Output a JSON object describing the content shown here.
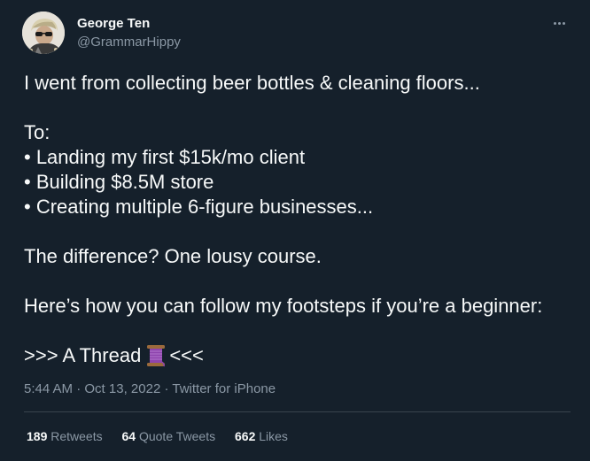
{
  "author": {
    "name": "George Ten",
    "handle": "@GrammarHippy",
    "avatar_icon": "profile-photo-avatar"
  },
  "tweet": {
    "lines": [
      "I went from collecting beer bottles & cleaning floors...",
      "",
      "To:",
      "• Landing my first $15k/mo client",
      "• Building $8.5M store",
      "• Creating multiple 6-figure businesses...",
      "",
      "The difference? One lousy course.",
      "",
      "Here’s how you can follow my footsteps if you’re a beginner:",
      ""
    ],
    "thread_prefix": ">>> A Thread",
    "thread_emoji_icon": "thread-spool-icon",
    "thread_suffix": "<<<"
  },
  "meta": {
    "time": "5:44 AM",
    "date": "Oct 13, 2022",
    "source": "Twitter for iPhone",
    "separator": "·"
  },
  "stats": {
    "retweets_count": "189",
    "retweets_label": "Retweets",
    "quotes_count": "64",
    "quotes_label": "Quote Tweets",
    "likes_count": "662",
    "likes_label": "Likes"
  },
  "colors": {
    "background": "#15202b",
    "text_primary": "#f7f9f9",
    "text_secondary": "#8b98a5",
    "divider": "#38444d"
  }
}
